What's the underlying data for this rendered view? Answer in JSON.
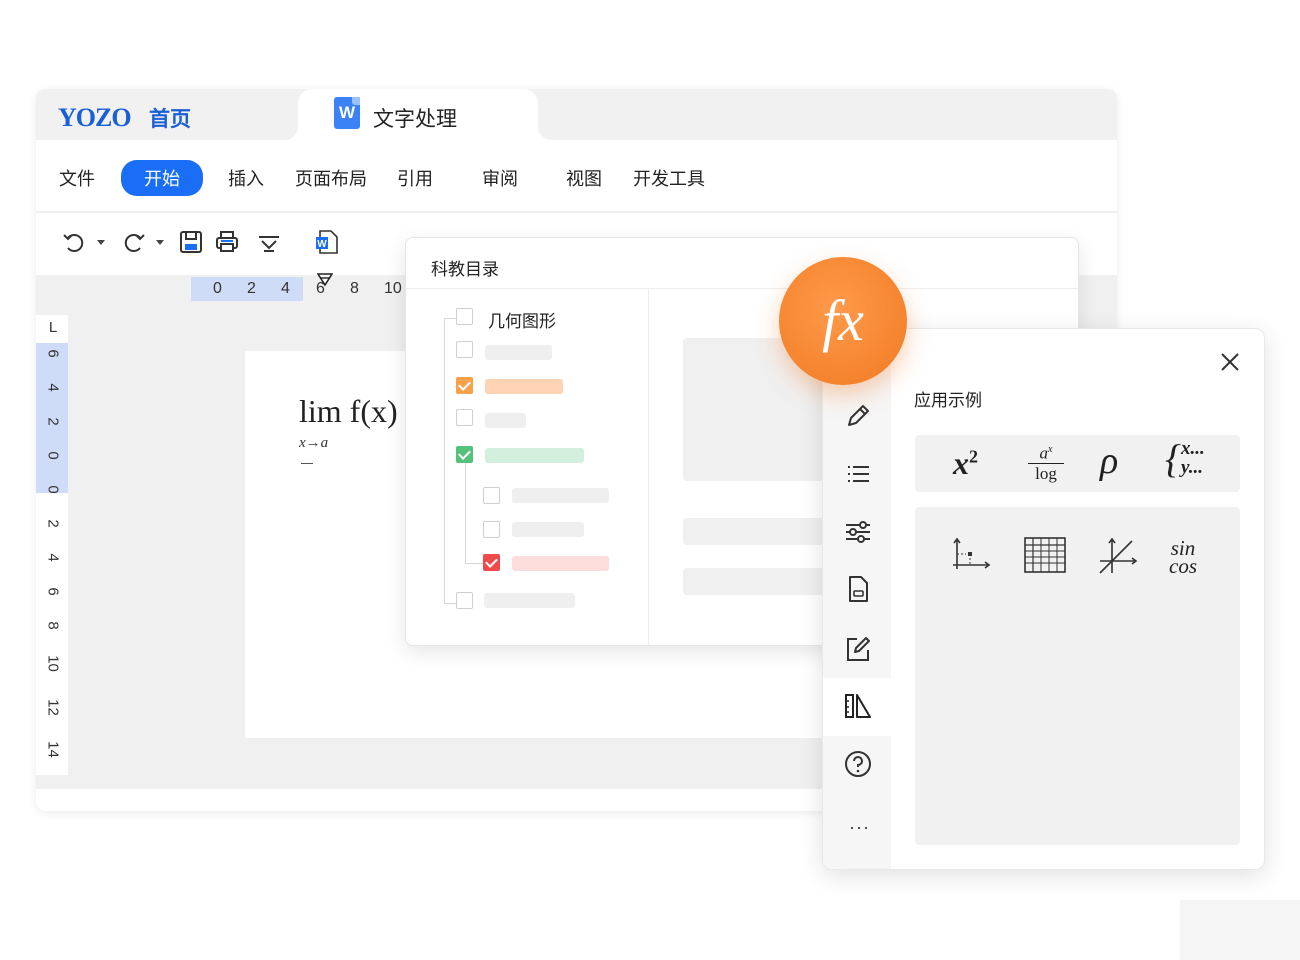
{
  "header": {
    "logo": "YOZO",
    "home_label": "首页",
    "doc_tab_icon": "W",
    "doc_tab_label": "文字处理"
  },
  "menu": {
    "items": [
      "文件",
      "开始",
      "插入",
      "页面布局",
      "引用",
      "审阅",
      "视图",
      "开发工具"
    ],
    "active": "开始"
  },
  "toolbar": {
    "icons": [
      "undo-icon",
      "redo-icon",
      "save-icon",
      "print-icon",
      "format-icon",
      "word-doc-icon"
    ]
  },
  "ruler": {
    "horizontal": [
      "0",
      "2",
      "4",
      "6",
      "8",
      "10"
    ],
    "vertical_corner": "L",
    "vertical": [
      "6",
      "4",
      "2",
      "0",
      "0",
      "2",
      "4",
      "6",
      "8",
      "10",
      "12",
      "14"
    ]
  },
  "document": {
    "formula_main": "lim f(x)",
    "formula_sub": "x→a"
  },
  "catalog": {
    "title": "科教目录",
    "tree_label": "几何图形",
    "colors": {
      "orange": "#f8a24c",
      "green": "#55c27a",
      "red": "#ef4a4a",
      "orange_bar": "#fdd3b4",
      "green_bar": "#d3f0de",
      "red_bar": "#fddcdc"
    }
  },
  "formula_panel": {
    "badge": "fx",
    "title": "应用示例",
    "symbols": [
      "x²",
      "aˣ/log",
      "ρ",
      "{x… y…"
    ],
    "grid_items": [
      "coordinate-icon",
      "table-icon",
      "axis-angle-icon",
      "sin cos"
    ],
    "grid_trig_top": "sin",
    "grid_trig_bottom": "cos",
    "side_icons": [
      "pencil-icon",
      "list-icon",
      "sliders-icon",
      "document-icon",
      "edit-icon",
      "ruler-triangle-icon",
      "help-icon"
    ],
    "more_label": "···",
    "accent": "#f07a22"
  }
}
